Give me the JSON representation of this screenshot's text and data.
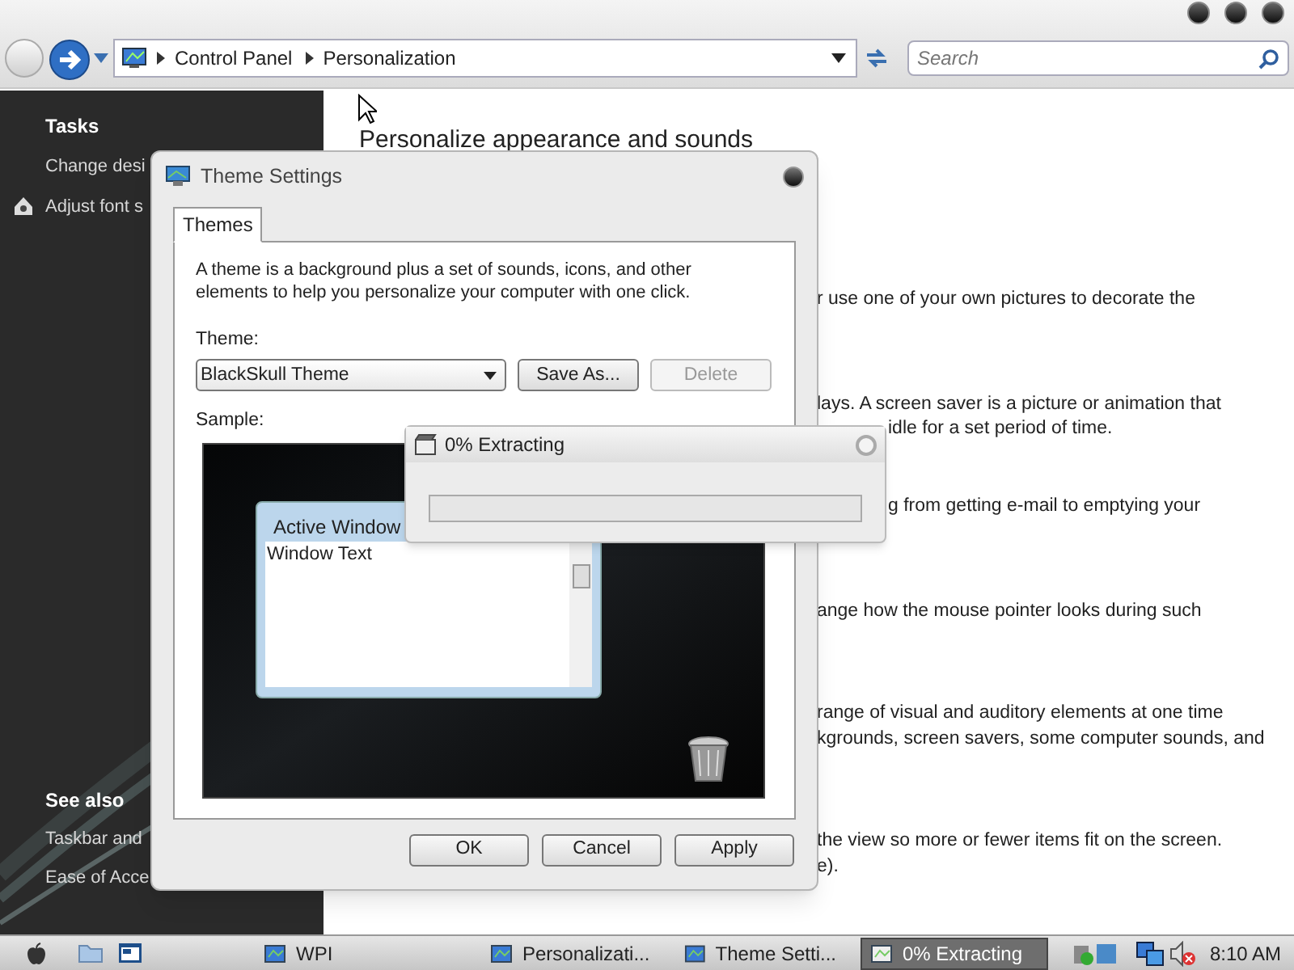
{
  "main_window": {
    "nav": {
      "breadcrumb": [
        "Control Panel",
        "Personalization"
      ],
      "search": {
        "placeholder": "Search"
      }
    },
    "sidebar": {
      "tasks_heading": "Tasks",
      "tasks": [
        {
          "label": "Change desi",
          "has_icon": false
        },
        {
          "label": "Adjust font s",
          "has_icon": true
        }
      ],
      "see_also_heading": "See also",
      "see_also": [
        "Taskbar and",
        "Ease of Acce"
      ]
    },
    "content": {
      "heading": "Personalize appearance and sounds",
      "fragments": [
        "r use one of your own pictures to decorate the",
        "lays. A screen saver is a picture or animation that",
        "idle for a set period of time.",
        "g from getting e-mail to emptying your",
        "ange how the mouse pointer looks during such",
        "range of visual and auditory elements at one time",
        "kgrounds, screen savers, some computer sounds, and",
        "the view so more or fewer items fit on the screen.",
        "e)."
      ]
    }
  },
  "theme_dialog": {
    "title": "Theme Settings",
    "tabs": [
      {
        "label": "Themes",
        "selected": true
      }
    ],
    "description": "A theme is a background plus a set of sounds, icons, and other elements to help you personalize your computer with one click.",
    "theme_label": "Theme:",
    "theme_value": "BlackSkull Theme",
    "actions": [
      {
        "label": "Save As...",
        "disabled": false
      },
      {
        "label": "Delete",
        "disabled": true
      }
    ],
    "sample_label": "Sample:",
    "sample": {
      "active_window": "Active Window",
      "window_text": "Window Text"
    },
    "buttons": [
      "OK",
      "Cancel",
      "Apply"
    ]
  },
  "extract_dialog": {
    "title": "0% Extracting",
    "level": 0
  },
  "taskbar": {
    "tasks": [
      {
        "label": "WPI",
        "selected": false
      },
      {
        "label": "Personalizati...",
        "selected": false
      },
      {
        "label": "Theme Setti...",
        "selected": false
      },
      {
        "label": "0% Extracting",
        "selected": true
      }
    ],
    "clock": "8:10 AM"
  }
}
